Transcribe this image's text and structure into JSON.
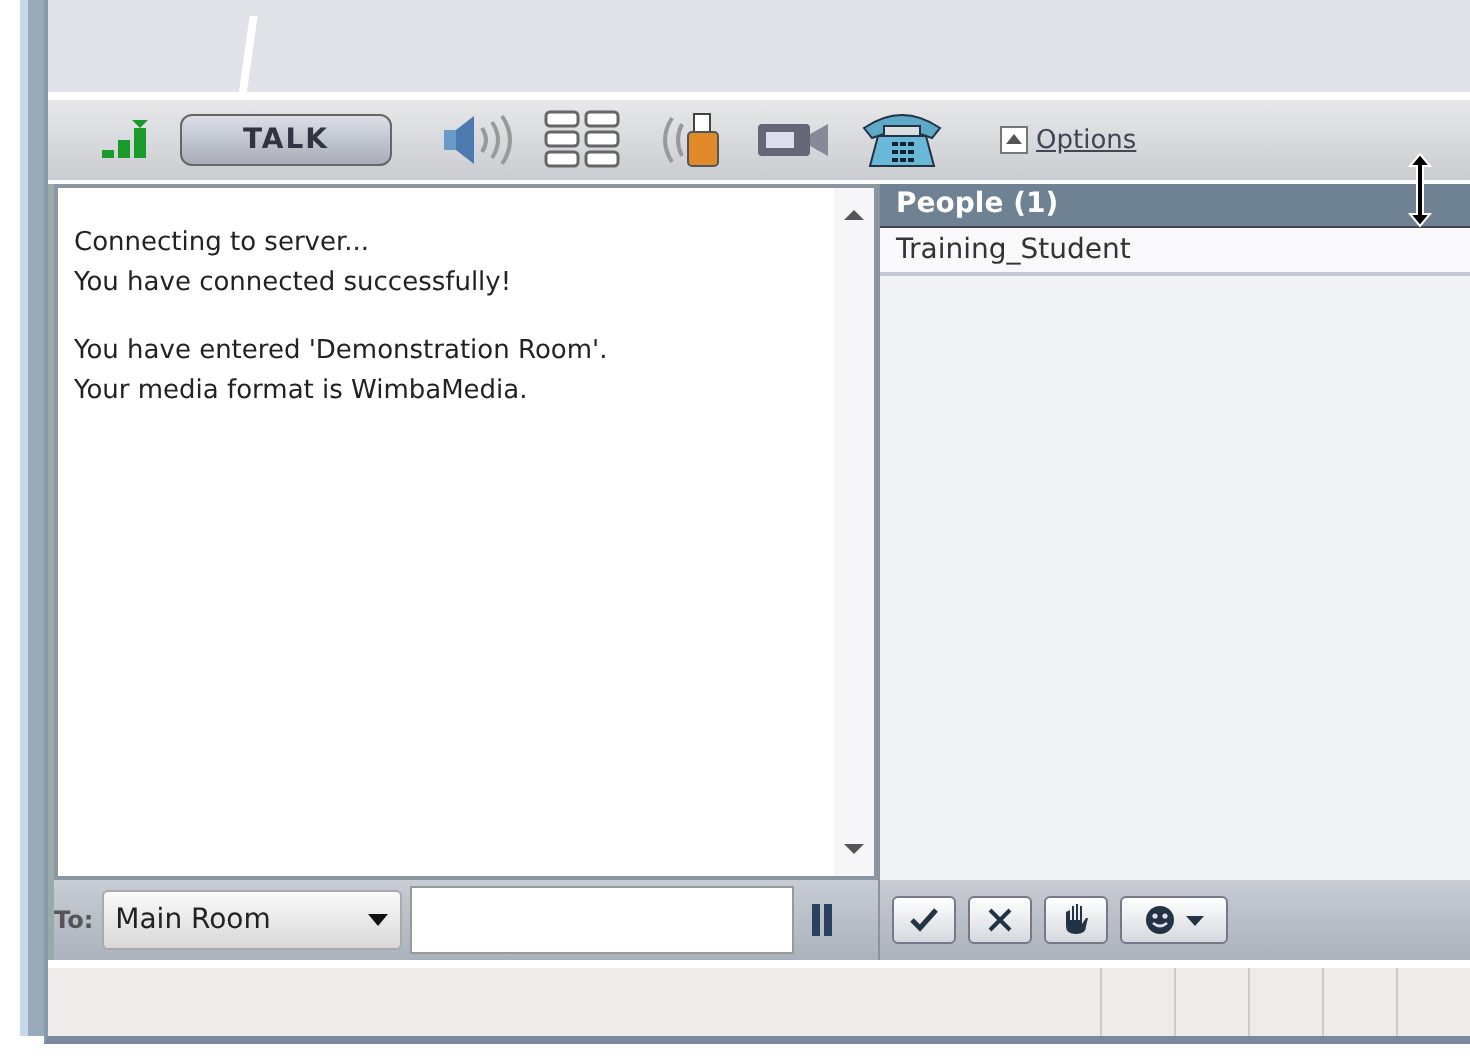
{
  "toolbar": {
    "talk_button": "TALK",
    "options_link": "Options"
  },
  "chat": {
    "message_groups": [
      [
        "Connecting to server...",
        "You have connected successfully!"
      ],
      [
        "You have entered 'Demonstration Room'.",
        "Your media format is WimbaMedia."
      ]
    ]
  },
  "compose": {
    "to_label": "To:",
    "recipient": "Main Room"
  },
  "people": {
    "title": "People (1)",
    "items": [
      {
        "name": "Training_Student",
        "selected": false
      }
    ]
  }
}
